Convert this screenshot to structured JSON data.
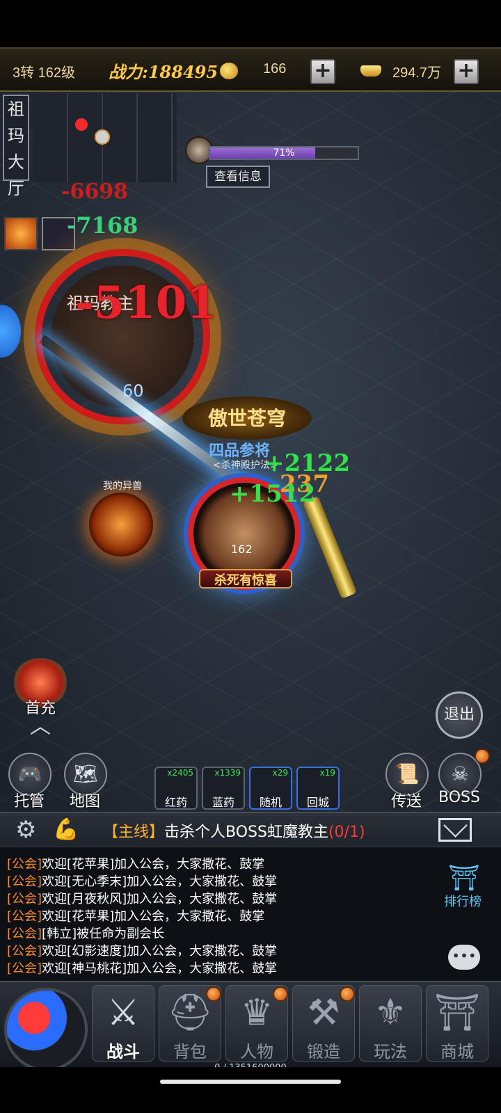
{
  "top_bar": {
    "level": "3转 162级",
    "power": "战力:188495",
    "currency1": "166",
    "currency2": "294.7万",
    "plus": "+"
  },
  "location": {
    "name": "祖玛大厅"
  },
  "boss": {
    "hp_percent_text": "71%",
    "hp_fraction": 0.71,
    "view_info": "查看信息",
    "name": "祖玛教主",
    "level": "60"
  },
  "damage": {
    "d1": "-6698",
    "d2": "-7168",
    "d3": "-5101",
    "d4": "+2122",
    "d5": "237",
    "d6": "+1512"
  },
  "player": {
    "title": "傲世苍穹",
    "rank": "四品参将",
    "guild": "<杀神殿护法>",
    "level": "162",
    "banner": "杀死有惊喜"
  },
  "pet": {
    "label": "我的异兽"
  },
  "first_recharge": {
    "label": "首充"
  },
  "exit": {
    "label": "退出"
  },
  "quick": {
    "auto": "托管",
    "map": "地图",
    "teleport": "传送",
    "boss": "BOSS"
  },
  "items": [
    {
      "count": "x2405",
      "label": "红药"
    },
    {
      "count": "x1339",
      "label": "蓝药"
    },
    {
      "count": "x29",
      "label": "随机"
    },
    {
      "count": "x19",
      "label": "回城"
    }
  ],
  "quest": {
    "tag": "【主线】",
    "desc": "击杀个人BOSS虹魔教主",
    "progress": "(0/1)"
  },
  "chat": [
    {
      "tag": "[公会]",
      "text": "欢迎[花苹果]加入公会，大家撒花、鼓掌"
    },
    {
      "tag": "[公会]",
      "text": "欢迎[无心季末]加入公会，大家撒花、鼓掌"
    },
    {
      "tag": "[公会]",
      "text": "欢迎[月夜秋风]加入公会，大家撒花、鼓掌"
    },
    {
      "tag": "[公会]",
      "text": "欢迎[花苹果]加入公会，大家撒花、鼓掌"
    },
    {
      "tag": "[公会]",
      "text": "[韩立]被任命为副会长"
    },
    {
      "tag": "[公会]",
      "text": "欢迎[幻影速度]加入公会，大家撒花、鼓掌"
    },
    {
      "tag": "[公会]",
      "text": "欢迎[神马桃花]加入公会，大家撒花、鼓掌"
    }
  ],
  "rank": {
    "label": "排行榜"
  },
  "nav": [
    {
      "label": "战斗",
      "icon": "crossed-swords-icon"
    },
    {
      "label": "背包",
      "icon": "bag-icon"
    },
    {
      "label": "人物",
      "icon": "character-icon"
    },
    {
      "label": "锻造",
      "icon": "anvil-icon"
    },
    {
      "label": "玩法",
      "icon": "gameplay-icon"
    },
    {
      "label": "商城",
      "icon": "shop-icon"
    }
  ],
  "exp": "0 / 1351600000",
  "colors": {
    "accent_gold": "#ffc94a",
    "hp_purple": "#9a6fd0",
    "damage_red": "#e8232b",
    "heal_green": "#2fe34a",
    "guild_tag": "#ff8c2a"
  }
}
